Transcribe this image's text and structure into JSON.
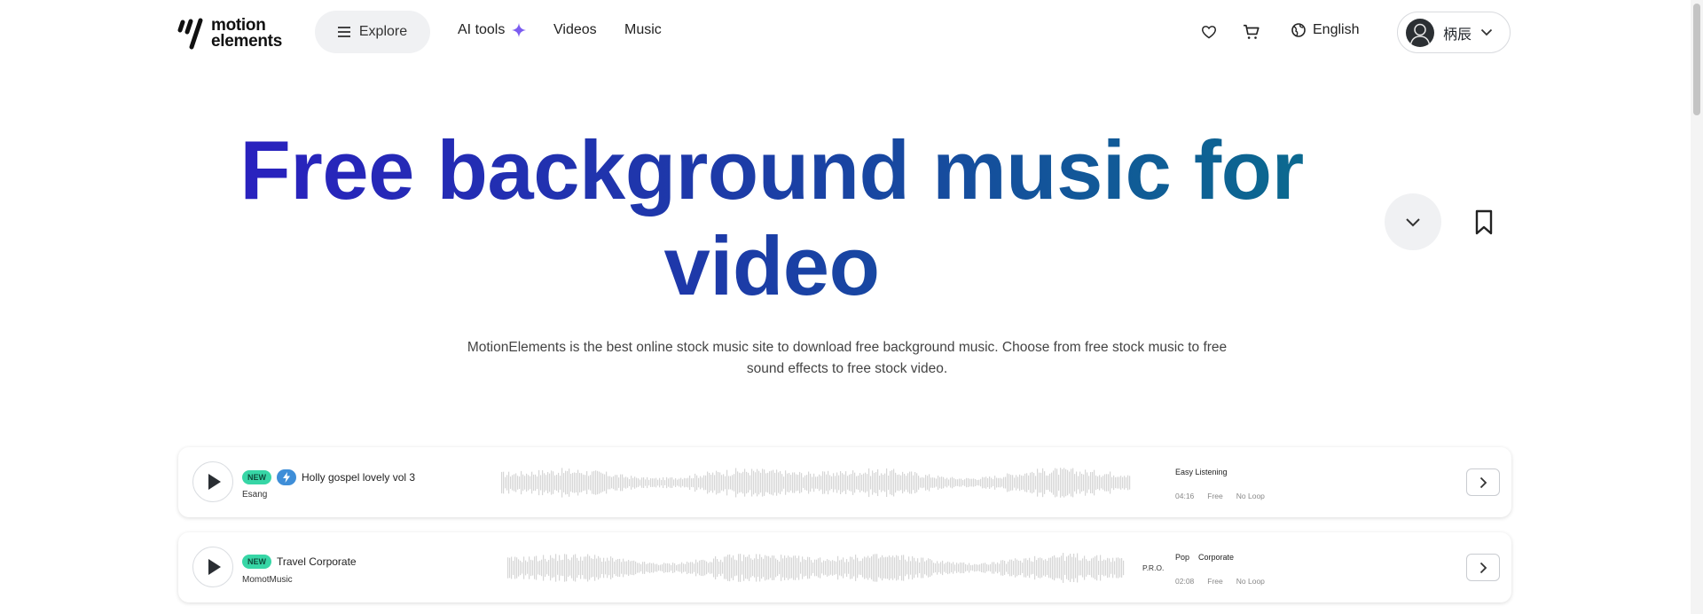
{
  "header": {
    "logo_line1": "motion",
    "logo_line2": "elements",
    "explore_label": "Explore",
    "nav": [
      {
        "label": "AI tools"
      },
      {
        "label": "Videos"
      },
      {
        "label": "Music"
      }
    ],
    "language": "English",
    "user_name": "柄辰"
  },
  "hero": {
    "title_line1": "Free background music for",
    "title_line2": "video",
    "description_line1": "MotionElements is the best online stock music site to download free background music. Choose from free stock music to free",
    "description_line2": "sound effects to free stock video."
  },
  "tracks": [
    {
      "badge": "NEW",
      "title": "Holly gospel lovely vol 3",
      "artist": "Esang",
      "tags": [
        "Easy Listening"
      ],
      "duration": "04:16",
      "price": "Free",
      "loop": "No Loop",
      "pro": ""
    },
    {
      "badge": "NEW",
      "title": "Travel Corporate",
      "artist": "MomotMusic",
      "tags": [
        "Pop",
        "Corporate"
      ],
      "duration": "02:08",
      "price": "Free",
      "loop": "No Loop",
      "pro": "P.R.O."
    }
  ],
  "colors": {
    "title_gradient_start": "#2a1fc0",
    "title_gradient_end": "#0a6c8e",
    "badge_new": "#37d6a6",
    "badge_bolt": "#3e8ed8",
    "ai_sparkle": "#7b5cf0"
  }
}
